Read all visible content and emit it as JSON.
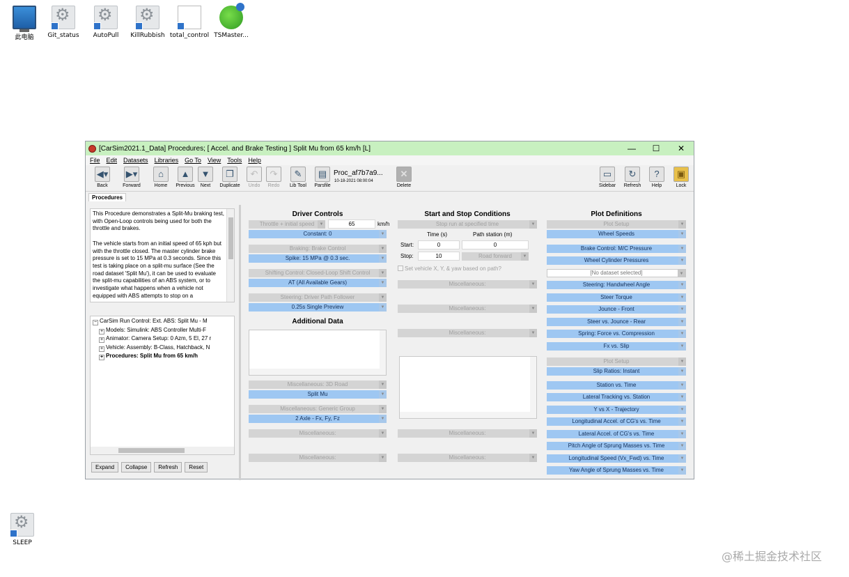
{
  "desktop": {
    "icons": [
      {
        "label": "此电脑",
        "icon": "computer-icon"
      },
      {
        "label": "Git_status",
        "icon": "shortcut-icon"
      },
      {
        "label": "AutoPull",
        "icon": "shortcut-icon"
      },
      {
        "label": "KillRubbish",
        "icon": "shortcut-icon"
      },
      {
        "label": "total_control",
        "icon": "file-icon"
      },
      {
        "label": "TSMaster...",
        "icon": "tsmaster-icon"
      },
      {
        "label": "SLEEP",
        "icon": "shortcut-icon"
      }
    ],
    "watermark": "@稀土掘金技术社区"
  },
  "window": {
    "title": "[CarSim2021.1_Data] Procedures; [ Accel. and Brake Testing ] Split Mu from 65 km/h [L]",
    "controls": {
      "minimize": "—",
      "maximize": "☐",
      "close": "✕"
    },
    "menu": [
      "File",
      "Edit",
      "Datasets",
      "Libraries",
      "Go To",
      "View",
      "Tools",
      "Help"
    ],
    "toolbar": {
      "back": "Back",
      "forward": "Forward",
      "home": "Home",
      "previous": "Previous",
      "next": "Next",
      "duplicate": "Duplicate",
      "undo": "Undo",
      "redo": "Redo",
      "libtool": "Lib Tool",
      "parsfile": "Parsfile",
      "delete": "Delete",
      "sidebar": "Sidebar",
      "refresh": "Refresh",
      "help": "Help",
      "lock": "Lock",
      "proc_name": "Proc_af7b7a9...",
      "proc_date": "10-18-2021 08:00:04"
    },
    "tab": "Procedures"
  },
  "left": {
    "description": [
      "This Procedure demonstrates a Split-Mu braking test, with Open-Loop controls being used for both the throttle and brakes.",
      "The vehicle starts from an initial speed of 65 kph but with the throttle closed. The master cylinder brake pressure is set to 15 MPa at 0.3 seconds. Since this test is taking place on a split-mu surface (See the road dataset 'Split Mu'), it can be used to evaluate the split-mu capabilities of an ABS system, or to investigate what happens when a vehicle not equipped with ABS attempts to stop on a"
    ],
    "tree": [
      {
        "text": "CarSim Run Control: Ext. ABS: Split Mu - M",
        "sign": "−"
      },
      {
        "text": "Models: Simulink: ABS Controller Multi-F",
        "sign": "+"
      },
      {
        "text": "Animator: Camera Setup: 0 Azm, 5 El, 27 r",
        "sign": "+"
      },
      {
        "text": "Vehicle: Assembly: B-Class, Hatchback, N",
        "sign": "+"
      },
      {
        "text": "Procedures: Split Mu from 65 km/h",
        "sign": "+"
      }
    ],
    "buttons": {
      "expand": "Expand",
      "collapse": "Collapse",
      "refresh": "Refresh",
      "reset": "Reset"
    }
  },
  "driver": {
    "title": "Driver Controls",
    "speed_header": "Throttle + initial speed",
    "speed_value": "65",
    "speed_unit": "km/h",
    "speed_dataset": "Constant: 0",
    "braking_header": "Braking: Brake Control",
    "braking_dataset": "Spike: 15 MPa @ 0.3 sec.",
    "shifting_header": "Shifting Control: Closed-Loop Shift Control",
    "shifting_dataset": "AT (All Available Gears)",
    "steering_header": "Steering: Driver Path Follower",
    "steering_dataset": "0.25s Single Preview"
  },
  "additional": {
    "title": "Additional Data",
    "road_header": "Miscellaneous: 3D Road",
    "road_dataset": "Split Mu",
    "generic_header": "Miscellaneous: Generic Group",
    "generic_dataset": "2 Axle - Fx, Fy, Fz",
    "misc1": "Miscellaneous:",
    "misc2": "Miscellaneous:"
  },
  "startstop": {
    "title": "Start and Stop Conditions",
    "stop_mode": "Stop run at specified time",
    "col_time": "Time (s)",
    "col_path": "Path station (m)",
    "start_label": "Start:",
    "start_time": "0",
    "start_path": "0",
    "stop_label": "Stop:",
    "stop_time": "10",
    "road_dir": "Road forward",
    "checkbox_label": "Set vehicle X, Y, & yaw based on path?",
    "misc": [
      "Miscellaneous:",
      "Miscellaneous:",
      "Miscellaneous:",
      "Miscellaneous:",
      "Miscellaneous:"
    ]
  },
  "plots": {
    "title": "Plot Definitions",
    "setup1": "Plot Setup",
    "setup1_value": "Wheel Speeds",
    "group1": [
      "Brake Control: M/C Pressure",
      "Wheel Cylinder Pressures",
      "[No dataset selected]",
      "Steering: Handwheel Angle",
      "Steer Torque",
      "Jounce - Front",
      "Steer vs. Jounce - Rear",
      "Spring: Force vs. Compression",
      "Fx vs. Slip"
    ],
    "setup2": "Plot Setup",
    "setup2_value": "Slip Ratios: Instant",
    "group2": [
      "Station vs. Time",
      "Lateral Tracking vs. Station",
      "Y vs X - Trajectory",
      "Longitudinal Accel. of CG's vs. Time",
      "Lateral Accel. of CG's vs. Time",
      "Pitch Angle of Sprung Masses vs. Time",
      "Longitudinal Speed (Vx_Fwd) vs. Time",
      "Yaw Angle of Sprung Masses vs. Time"
    ]
  }
}
